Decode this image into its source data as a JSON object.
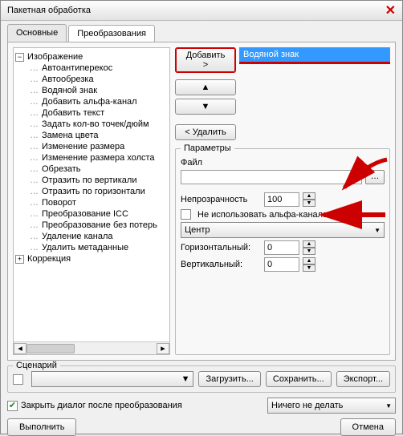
{
  "window": {
    "title": "Пакетная обработка"
  },
  "tabs": {
    "main": "Основные",
    "transforms": "Преобразования",
    "active": "transforms"
  },
  "tree": {
    "root": "Изображение",
    "items": [
      "Автоантиперекос",
      "Автообрезка",
      "Водяной знак",
      "Добавить альфа-канал",
      "Добавить текст",
      "Задать кол-во точек/дюйм",
      "Замена цвета",
      "Изменение размера",
      "Изменение размера холста",
      "Обрезать",
      "Отразить по вертикали",
      "Отразить по горизонтали",
      "Поворот",
      "Преобразование ICC",
      "Преобразование без потерь",
      "Удаление канала",
      "Удалить метаданные"
    ],
    "correction": "Коррекция"
  },
  "actions": {
    "add": "Добавить >",
    "delete": "< Удалить",
    "selected": "Водяной знак"
  },
  "params": {
    "legend": "Параметры",
    "file_label": "Файл",
    "file_value": "",
    "opacity_label": "Непрозрачность",
    "opacity_value": "100",
    "no_alpha": "Не использовать альфа-канал",
    "no_alpha_checked": false,
    "position_value": "Центр",
    "h_label": "Горизонтальный:",
    "h_value": "0",
    "v_label": "Вертикальный:",
    "v_value": "0"
  },
  "scenario": {
    "legend": "Сценарий",
    "value": "",
    "load": "Загрузить...",
    "save": "Сохранить...",
    "export": "Экспорт..."
  },
  "footer": {
    "close_after": "Закрыть диалог после преобразования",
    "close_after_checked": true,
    "after_action": "Ничего не делать",
    "run": "Выполнить",
    "cancel": "Отмена"
  }
}
